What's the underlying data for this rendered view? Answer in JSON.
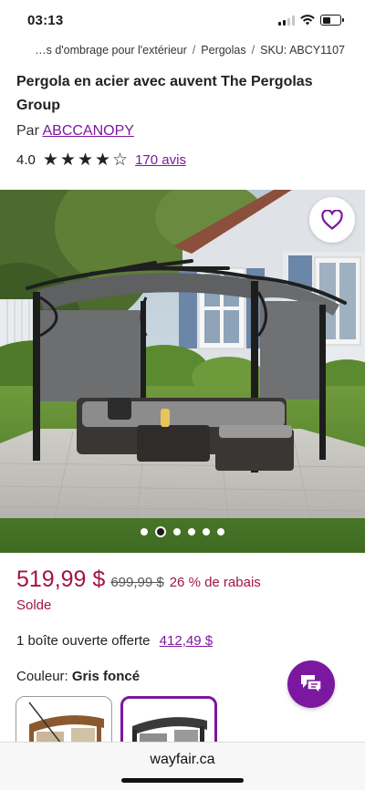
{
  "status_bar": {
    "time": "03:13",
    "battery_level": 0.45
  },
  "breadcrumb": {
    "items": [
      "…s d'ombrage pour l'extérieur",
      "Pergolas",
      "SKU: ABCY1107"
    ],
    "separator": "/"
  },
  "product": {
    "title": "Pergola en acier avec auvent The Pergolas Group",
    "brand_prefix": "Par",
    "brand": "ABCCANOPY",
    "rating_value": "4.0",
    "rating_stars": 4,
    "rating_max": 5,
    "reviews": "170 avis"
  },
  "gallery": {
    "image_count": 6,
    "active_index": 1,
    "favorite_icon": "heart-outline-icon"
  },
  "pricing": {
    "price": "519,99 $",
    "old_price": "699,99 $",
    "discount": "26 % de rabais",
    "sale_label": "Solde"
  },
  "open_box": {
    "label": "1 boîte ouverte offerte",
    "price": "412,49 $"
  },
  "color": {
    "label": "Couleur:",
    "value": "Gris foncé",
    "selected_index": 1
  },
  "chat": {
    "icon": "chat-bubbles-icon"
  },
  "url_bar": {
    "url": "wayfair.ca"
  },
  "colors": {
    "accent": "#7b189f",
    "price": "#a4134a"
  }
}
